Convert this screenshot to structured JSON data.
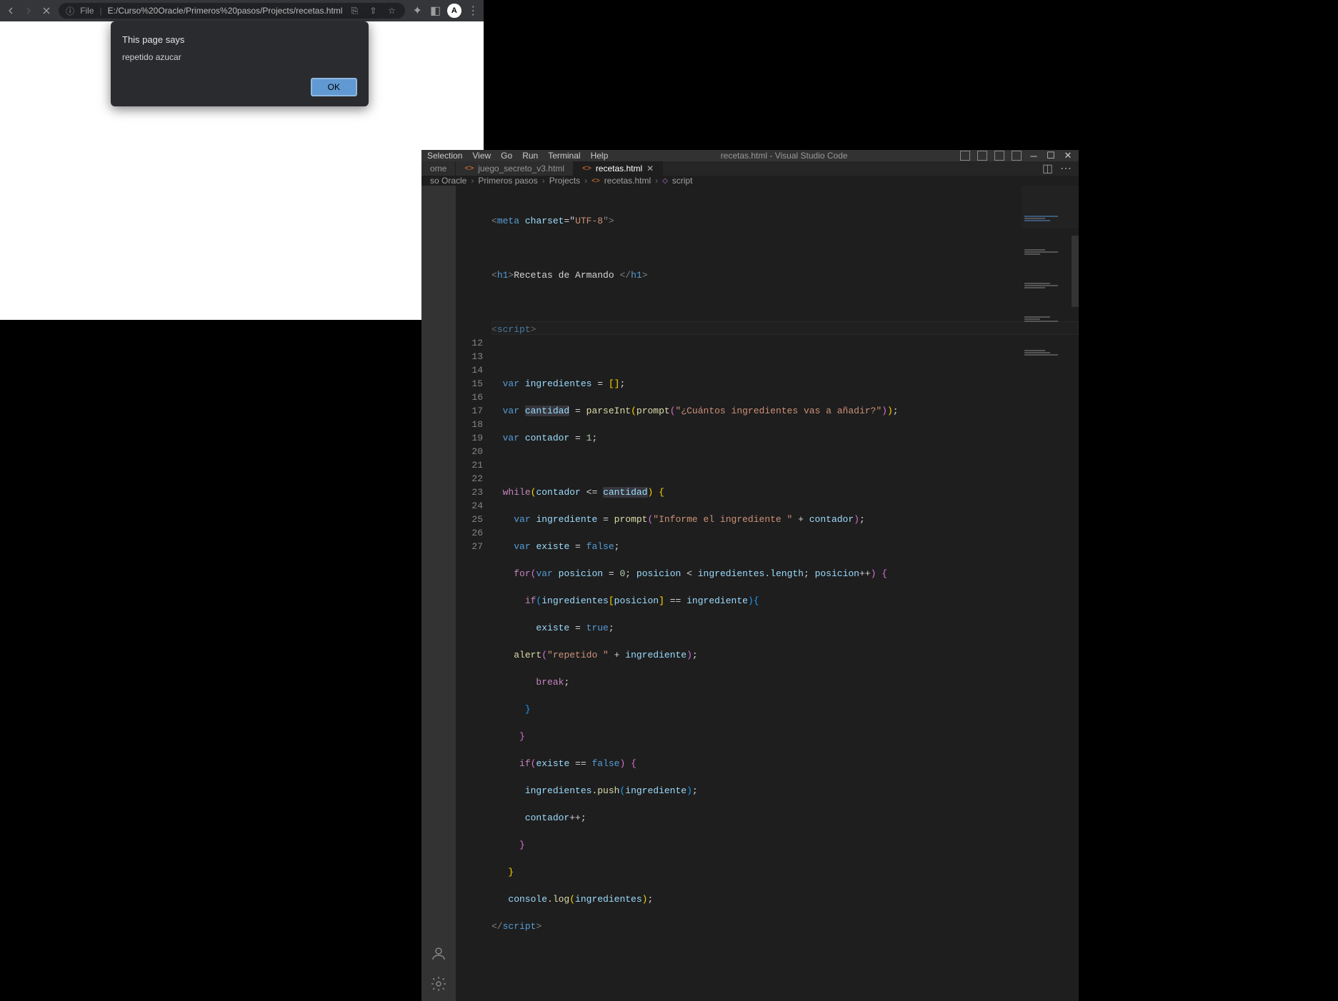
{
  "browser": {
    "url_prefix": "File",
    "url": "E:/Curso%20Oracle/Primeros%20pasos/Projects/recetas.html"
  },
  "dialog": {
    "title": "This page says",
    "message": "repetido azucar",
    "ok": "OK"
  },
  "vscode": {
    "menu": [
      "Selection",
      "View",
      "Go",
      "Run",
      "Terminal",
      "Help"
    ],
    "title": "recetas.html - Visual Studio Code",
    "tabs": {
      "left_partial": "ome",
      "mid": "juego_secreto_v3.html",
      "active": "recetas.html"
    },
    "breadcrumb": {
      "p1": "so Oracle",
      "p2": "Primeros pasos",
      "p3": "Projects",
      "p4": "recetas.html",
      "p5": "script"
    },
    "gutter": [
      "12",
      "13",
      "14",
      "15",
      "16",
      "17",
      "18",
      "19",
      "20",
      "21",
      "22",
      "23",
      "24",
      "25",
      "26",
      "27"
    ],
    "code": {
      "meta_open": "<",
      "meta": "meta",
      "charset_attr": "charset",
      "eq_q": "=\"",
      "utf": "UTF-8",
      "qclose": "\">",
      "h1_open": "<",
      "h1": "h1",
      "gt": ">",
      "h1_text": "Recetas de Armando ",
      "h1_close_open": "</",
      "h1_close": ">",
      "script_open": "<",
      "script_tag": "script",
      "script_close_open": "</",
      "var": "var",
      "ingredientes": "ingredientes",
      "space_eq": " = ",
      "brackets": "[]",
      "semi": ";",
      "cantidad": "cantidad",
      "parseInt": "parseInt",
      "lp": "(",
      "rp": ")",
      "prompt": "prompt",
      "prompt_str1": "\"¿Cuántos ingredientes vas a añadir?\"",
      "rpsemi": ");",
      "contador": "contador",
      "eq1": " = ",
      "one": "1",
      "while": "while",
      "le": " <= ",
      "lbrace": " {",
      "ingrediente": "ingrediente",
      "prompt_str2": "\"Informe el ingrediente \"",
      "plus": " + ",
      "existe": "existe",
      "false": "false",
      "true": "true",
      "for": "for",
      "posicion": "posicion",
      "eq0": " = ",
      "zero": "0",
      "sc_sp": "; ",
      "lt": " < ",
      "length": ".length",
      "pp": "++",
      "rp_sp_lb": ") {",
      "if": "if",
      "idx_open": "[",
      "idx_close": "]",
      "eqeq": " == ",
      "rp_lb": "){",
      "alert": "alert",
      "rep_str": "\"repetido \"",
      "break": "break",
      "rbrace": "}",
      "push": ".push",
      "console": "console",
      "log": ".log"
    }
  }
}
